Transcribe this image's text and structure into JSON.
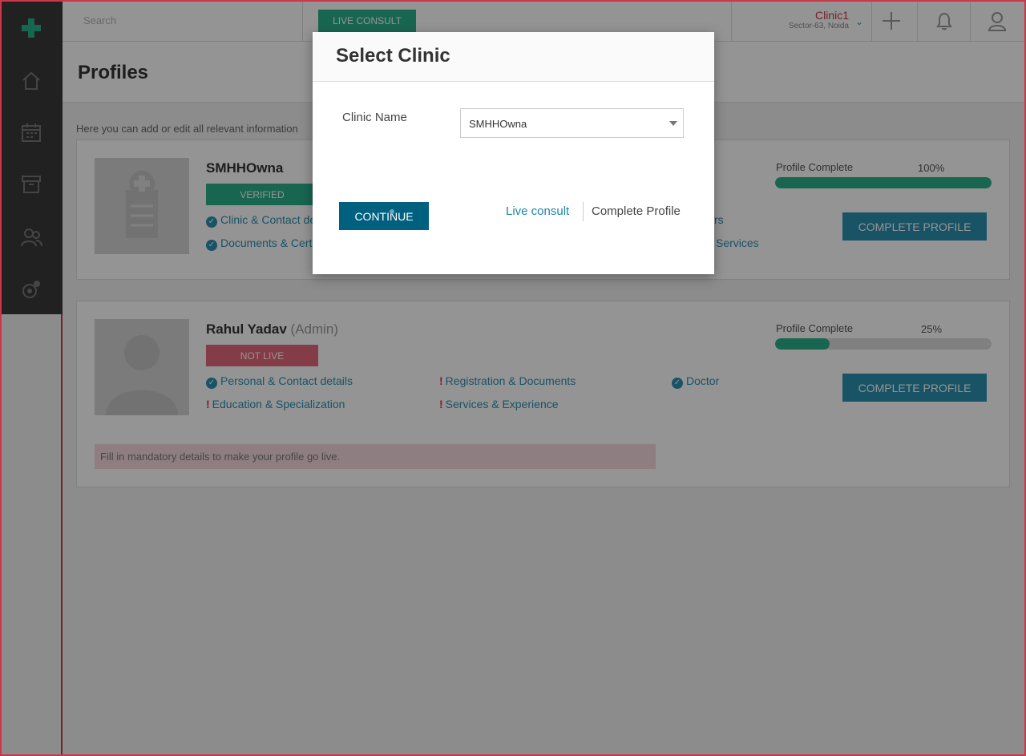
{
  "topbar": {
    "search_placeholder": "Search",
    "live_consult_label": "LIVE CONSULT",
    "clinic": {
      "name": "Clinic1",
      "location": "Sector-63, Noida"
    }
  },
  "page": {
    "title": "Profiles",
    "description": "Here you can add or edit all relevant information"
  },
  "profiles": [
    {
      "name": "SMHHOwna",
      "role": "",
      "status": "VERIFIED",
      "items": [
        {
          "label": "Clinic & Contact de",
          "state": "ok"
        },
        {
          "label": "Documents & Certi",
          "state": "ok"
        },
        {
          "label": "rs",
          "state": "none"
        },
        {
          "label": "Services",
          "state": "none"
        }
      ],
      "progress_label": "Profile Complete",
      "progress_value": "100%",
      "progress_fraction": 1.0,
      "button_label": "COMPLETE PROFILE"
    },
    {
      "name": "Rahul Yadav",
      "role": "(Admin)",
      "status": "NOT LIVE",
      "items": [
        {
          "label": "Personal & Contact details",
          "state": "ok"
        },
        {
          "label": "Registration & Documents",
          "state": "warn"
        },
        {
          "label": "Doctor",
          "state": "ok"
        },
        {
          "label": "Education & Specialization",
          "state": "warn"
        },
        {
          "label": "Services & Experience",
          "state": "warn"
        }
      ],
      "progress_label": "Profile Complete",
      "progress_value": "25%",
      "progress_fraction": 0.25,
      "button_label": "COMPLETE PROFILE",
      "hint": "Fill in mandatory details to make your profile go live."
    }
  ],
  "modal": {
    "title": "Select Clinic",
    "field_label": "Clinic Name",
    "selected_clinic": "SMHHOwna",
    "continue_label": "CONTINUE",
    "live_consult_link": "Live consult",
    "complete_profile_link": "Complete Profile"
  },
  "icons": {
    "logo": "medical-cross-icon",
    "nav": [
      "home-icon",
      "calendar-icon",
      "archive-icon",
      "users-icon",
      "settings-icon"
    ],
    "top": [
      "plus-icon",
      "bell-icon",
      "user-icon"
    ]
  },
  "colors": {
    "brand_green": "#2bb08a",
    "link_blue": "#2a8fb0",
    "alert_red": "#c9384a",
    "primary_button": "#00607f"
  }
}
